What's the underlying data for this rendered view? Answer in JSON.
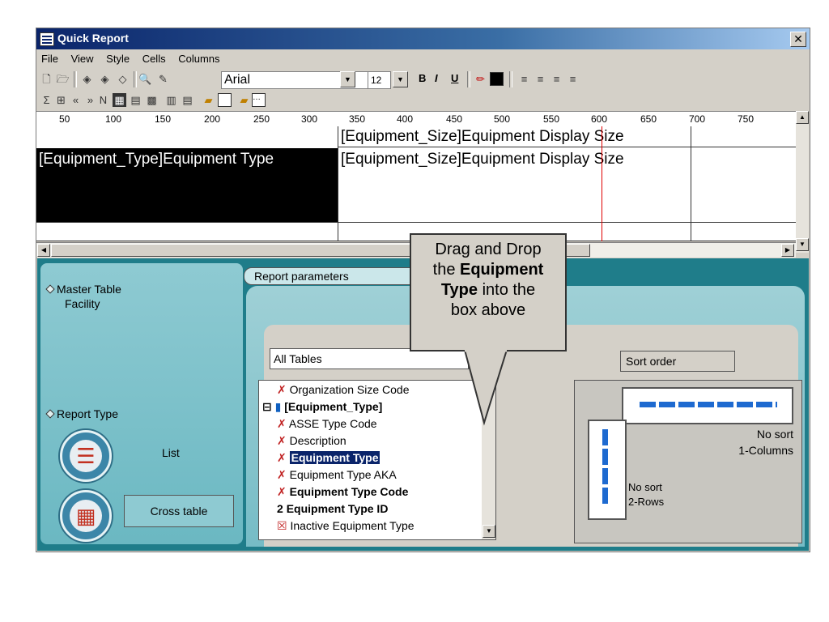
{
  "window": {
    "title": "Quick Report"
  },
  "menu": [
    "File",
    "View",
    "Style",
    "Cells",
    "Columns"
  ],
  "toolbar": {
    "font_name": "Arial",
    "font_size": "12",
    "bold": "B",
    "italic": "I",
    "underline": "U"
  },
  "ruler_ticks": [
    "50",
    "100",
    "150",
    "200",
    "250",
    "300",
    "350",
    "400",
    "450",
    "500",
    "550",
    "600",
    "650",
    "700",
    "750"
  ],
  "grid": {
    "header_cell": "[Equipment_Size]Equipment Display Size",
    "row_label": "[Equipment_Type]Equipment Type",
    "row_value": "[Equipment_Size]Equipment Display Size"
  },
  "left_panel": {
    "master_table_label": "Master Table",
    "master_table_value": "Facility",
    "report_type_label": "Report Type",
    "list_label": "List",
    "cross_table_label": "Cross table"
  },
  "params": {
    "tab_label": "Report parameters",
    "combo_value": "All Tables",
    "sort_order_label": "Sort order",
    "tree_items": [
      "Organization Size Code",
      "[Equipment_Type]",
      "ASSE Type Code",
      "Description",
      "Equipment Type",
      "Equipment Type AKA",
      "Equipment Type Code",
      "Equipment Type ID",
      "Inactive Equipment Type"
    ],
    "sort_col_text": "No sort",
    "sort_col_sub": "1-Columns",
    "sort_row_text": "No sort",
    "sort_row_sub": "2-Rows"
  },
  "callout": {
    "line1": "Drag and Drop",
    "line2_pre": "the ",
    "line2_bold": "Equipment",
    "line3_bold": "Type",
    "line3_post": " into the",
    "line4": "box above"
  }
}
